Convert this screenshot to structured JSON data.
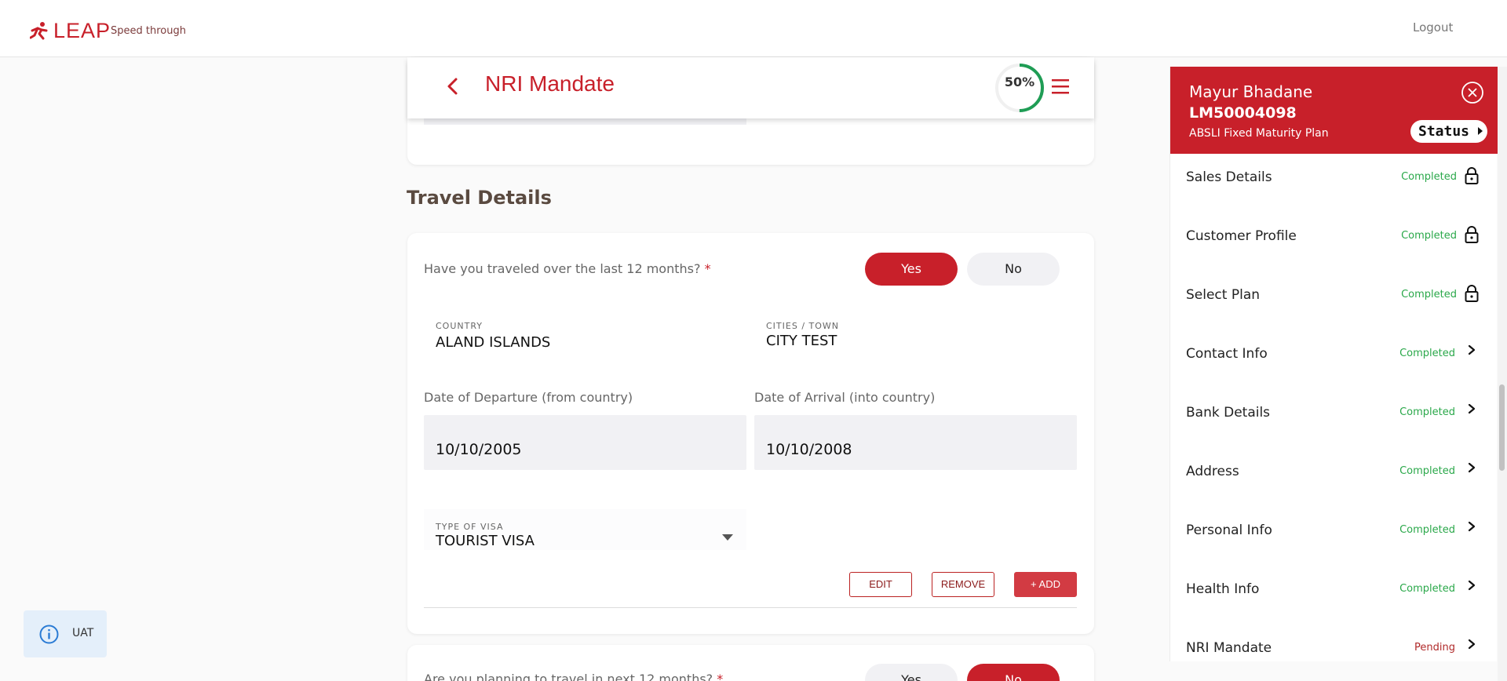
{
  "brand": {
    "name": "LEAP",
    "tagline": "Speed through"
  },
  "topbar": {
    "logout_label": "Logout"
  },
  "header": {
    "title": "NRI Mandate",
    "progress_text": "50%",
    "progress": 0.5
  },
  "travel_section": {
    "title": "Travel Details",
    "question": "Have you traveled over the last 12 months?",
    "required_mark": "*",
    "yes_label": "Yes",
    "no_label": "No",
    "selected": "Yes",
    "country_label": "COUNTRY",
    "country_value": "ALAND ISLANDS",
    "city_label": "CITIES / TOWN",
    "city_value": "CITY TEST",
    "departure_label": "Date of Departure (from country)",
    "departure_value": "10/10/2005",
    "arrival_label": "Date of Arrival (into country)",
    "arrival_value": "10/10/2008",
    "visa_label": "TYPE OF VISA",
    "visa_value": "TOURIST VISA",
    "edit_label": "EDIT",
    "remove_label": "REMOVE",
    "add_label": "+ ADD"
  },
  "future_travel": {
    "question": "Are you planning to travel in next 12 months?",
    "required_mark": "*",
    "yes_label": "Yes",
    "no_label": "No",
    "selected": "No"
  },
  "panel": {
    "customer_name": "Mayur Bhadane",
    "customer_code": "LM50004098",
    "plan_name": "ABSLI Fixed Maturity Plan",
    "status_label": "Status",
    "steps": [
      {
        "label": "Sales Details",
        "status": "Completed",
        "icon": "lock-icon"
      },
      {
        "label": "Customer Profile",
        "status": "Completed",
        "icon": "lock-icon"
      },
      {
        "label": "Select Plan",
        "status": "Completed",
        "icon": "lock-icon"
      },
      {
        "label": "Contact Info",
        "status": "Completed",
        "icon": "chevron-right-icon"
      },
      {
        "label": "Bank Details",
        "status": "Completed",
        "icon": "chevron-right-icon"
      },
      {
        "label": "Address",
        "status": "Completed",
        "icon": "chevron-right-icon"
      },
      {
        "label": "Personal Info",
        "status": "Completed",
        "icon": "chevron-right-icon"
      },
      {
        "label": "Health Info",
        "status": "Completed",
        "icon": "chevron-right-icon"
      },
      {
        "label": "NRI Mandate",
        "status": "Pending",
        "icon": "chevron-right-icon"
      }
    ]
  },
  "env_badge": {
    "label": "UAT"
  },
  "colors": {
    "brand_red": "#c8202a",
    "completed_green": "#2aa84a",
    "pending_red": "#b02a2a",
    "progress_green": "#1f9d55"
  }
}
